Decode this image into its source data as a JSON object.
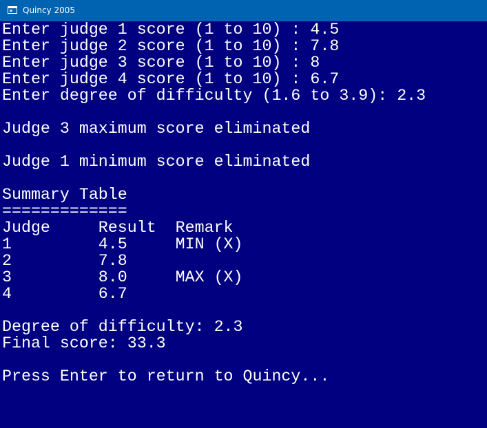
{
  "window": {
    "title": "Quincy 2005",
    "app_icon": "console-window-icon",
    "colors": {
      "titlebar": "#0063b1",
      "console_background": "#000080",
      "console_text": "#ffffff"
    }
  },
  "console": {
    "lines": [
      "Enter judge 1 score (1 to 10) : 4.5",
      "Enter judge 2 score (1 to 10) : 7.8",
      "Enter judge 3 score (1 to 10) : 8",
      "Enter judge 4 score (1 to 10) : 6.7",
      "Enter degree of difficulty (1.6 to 3.9): 2.3",
      "",
      "Judge 3 maximum score eliminated",
      "",
      "Judge 1 minimum score eliminated",
      "",
      "Summary Table",
      "=============",
      "Judge     Result  Remark",
      "1         4.5     MIN (X)",
      "2         7.8",
      "3         8.0     MAX (X)",
      "4         6.7",
      "",
      "Degree of difficulty: 2.3",
      "Final score: 33.3",
      "",
      "Press Enter to return to Quincy..."
    ]
  }
}
